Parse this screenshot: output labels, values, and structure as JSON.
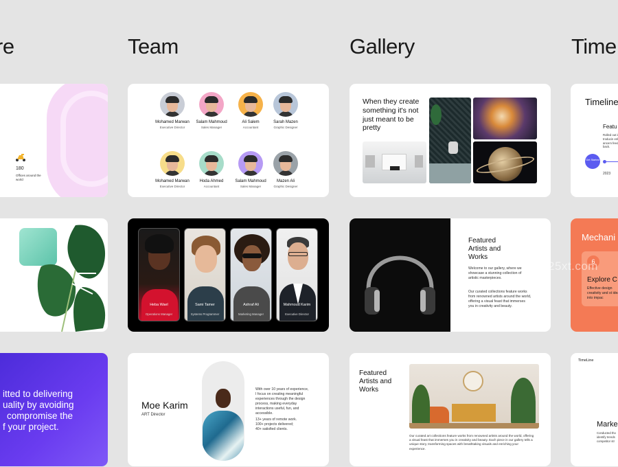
{
  "columns": {
    "feature_partial": "re",
    "team": "Team",
    "gallery": "Gallery",
    "timeline_partial": "Time"
  },
  "feature_card": {
    "stat_value": "180",
    "stat_label": "Offices around the world"
  },
  "mission_card": {
    "lines": [
      "itted to delivering",
      "uality by avoiding",
      "compromise the",
      "f your project."
    ]
  },
  "team_grid": {
    "members": [
      {
        "name": "Mohamed Marwan",
        "role": "Executive Director"
      },
      {
        "name": "Salam Mahmoud",
        "role": "Sales Manager"
      },
      {
        "name": "Ali Salem",
        "role": "Accountant"
      },
      {
        "name": "Sarah Mazen",
        "role": "Graphic Designer"
      },
      {
        "name": "Mohamed Marwan",
        "role": "Executive Director"
      },
      {
        "name": "Hoda Ahmed",
        "role": "Accountant"
      },
      {
        "name": "Salam Mahmoud",
        "role": "Sales Manager"
      },
      {
        "name": "Mazen Ali",
        "role": "Graphic Designer"
      }
    ],
    "colors": [
      "#c9cdd6",
      "#f3a6c6",
      "#f6b24a",
      "#b8c6d9",
      "#f7dd8a",
      "#a7dcc9",
      "#b69af4",
      "#9aa2a8"
    ]
  },
  "team_portraits": {
    "people": [
      {
        "name": "Heba Wael",
        "role": "Operations Manager"
      },
      {
        "name": "Sami Tamer",
        "role": "Systems Programmer"
      },
      {
        "name": "Ashraf Ali",
        "role": "Marketing Manager"
      },
      {
        "name": "Mahmoud Karim",
        "role": "Executive Director"
      }
    ]
  },
  "profile_card": {
    "name": "Moe Karim",
    "title": "ART Director",
    "bio": "With over 10 years of experience, I focus on creating meaningful experiences through the design process, making everyday interactions useful, fun, and accessible.",
    "stats": [
      "13+ years of remote work.",
      "100+ projects delivered;",
      "40+ satisfied clients."
    ]
  },
  "gallery_card1": {
    "heading": "When they create something it's not just meant to be pretty"
  },
  "gallery_card2": {
    "heading": "Featured Artists and Works",
    "para1": "Welcome to our gallery, where we showcase a stunning collection of artistic masterpieces.",
    "para2": "Our curated collections feature works from renowned artists around the world, offering a visual feast that immerses you in creativity and beauty."
  },
  "gallery_card3": {
    "heading": "Featured Artists and Works",
    "body": "Our curated art collections feature works from renowned artists around the world, offering a visual feast that immerses you in creativity and beauty. Each piece in our gallery tells a unique story, transforming spaces with breathtaking visuals and enriching your experience."
  },
  "timeline_card1": {
    "title": "Timeline",
    "feature": "Featu",
    "desc": "Rolled out introducin enhancem feedback.",
    "button": "Get Started",
    "year": "2023"
  },
  "timeline_card2": {
    "title": "Mechani",
    "number": "6",
    "subtitle": "Explore C",
    "desc": "Effective design creativity and st ideas into impac"
  },
  "timeline_card3": {
    "label": "TimeLine",
    "title": "Marke",
    "desc": "Conducted tho identify trends competitor str"
  },
  "watermark": "25xt.com",
  "colors": {
    "background": "#e4e4e4",
    "purple": "#6a3cf0",
    "orange": "#f47a55",
    "accent": "#5b5bf0"
  }
}
